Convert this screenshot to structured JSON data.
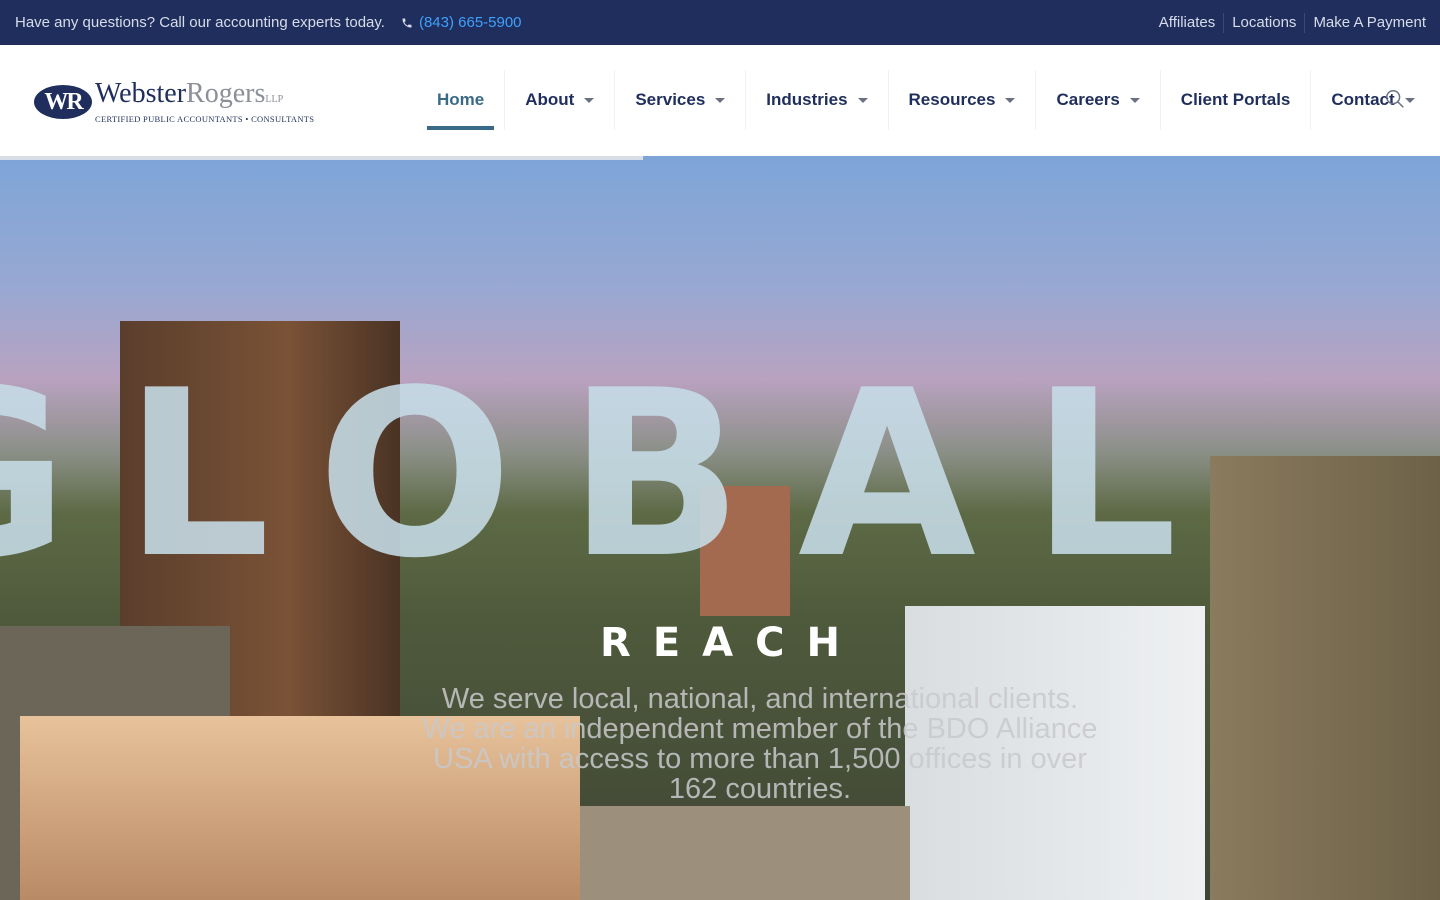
{
  "topbar": {
    "question": "Have any questions? Call our accounting experts today.",
    "phone": "(843) 665-5900",
    "links": [
      "Affiliates",
      "Locations",
      "Make A Payment"
    ]
  },
  "logo": {
    "mark": "WR",
    "name_a": "Webster",
    "name_b": "Rogers",
    "suffix": "LLP",
    "tagline": "Certified Public Accountants • Consultants"
  },
  "nav": {
    "items": [
      {
        "label": "Home",
        "dropdown": false,
        "active": true
      },
      {
        "label": "About",
        "dropdown": true
      },
      {
        "label": "Services",
        "dropdown": true
      },
      {
        "label": "Industries",
        "dropdown": true
      },
      {
        "label": "Resources",
        "dropdown": true
      },
      {
        "label": "Careers",
        "dropdown": true
      },
      {
        "label": "Client Portals",
        "dropdown": false
      },
      {
        "label": "Contact",
        "dropdown": true
      }
    ]
  },
  "hero": {
    "headline": "GLOBAL",
    "subheadline": "REACH",
    "description": "We serve local, national, and international clients. We are an independent member of the BDO Alliance USA with access to more than 1,500 offices in over 162 countries."
  },
  "colors": {
    "navy": "#1f2e5c",
    "accent": "#3a6a8a",
    "phone": "#3fa1ff"
  }
}
